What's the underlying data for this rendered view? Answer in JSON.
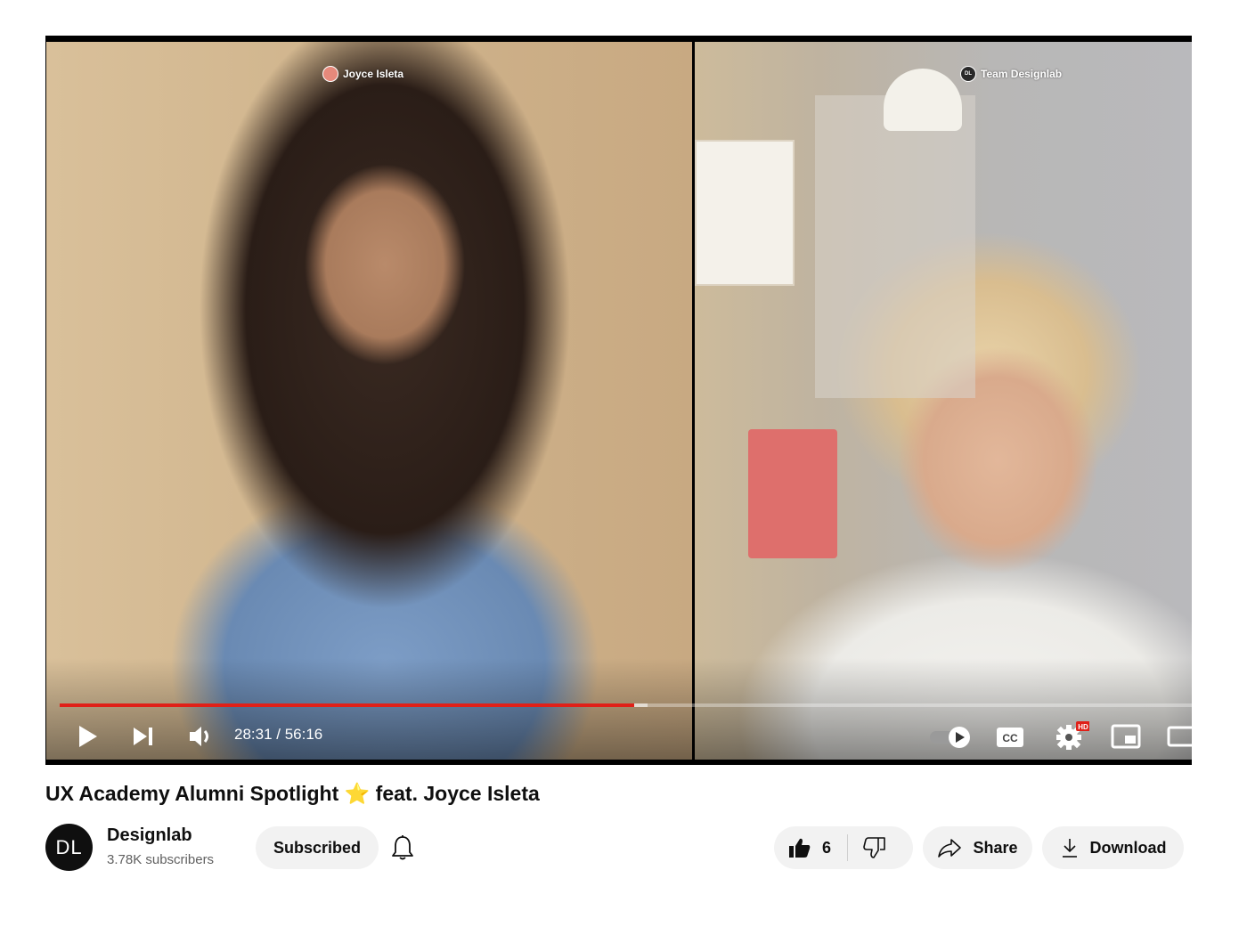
{
  "player": {
    "participant_left": "Joyce Isleta",
    "participant_right": "Team Designlab",
    "right_badge": "DL",
    "time_current": "28:31",
    "time_total": "56:16",
    "time_display": "28:31 / 56:16",
    "progress_fraction": 0.5071,
    "buffer_fraction": 0.5195,
    "hd_badge": "HD",
    "icons": [
      "play-icon",
      "next-icon",
      "volume-icon",
      "autoplay-toggle",
      "captions-icon",
      "settings-icon",
      "miniplayer-icon",
      "theater-icon"
    ],
    "accent_color": "#e02018"
  },
  "video": {
    "title": "UX Academy Alumni Spotlight ⭐ feat. Joyce Isleta"
  },
  "channel": {
    "avatar_text": "DL",
    "name": "Designlab",
    "subscribers": "3.78K subscribers",
    "subscribe_label": "Subscribed"
  },
  "actions": {
    "like_count": "6",
    "share_label": "Share",
    "download_label": "Download"
  }
}
